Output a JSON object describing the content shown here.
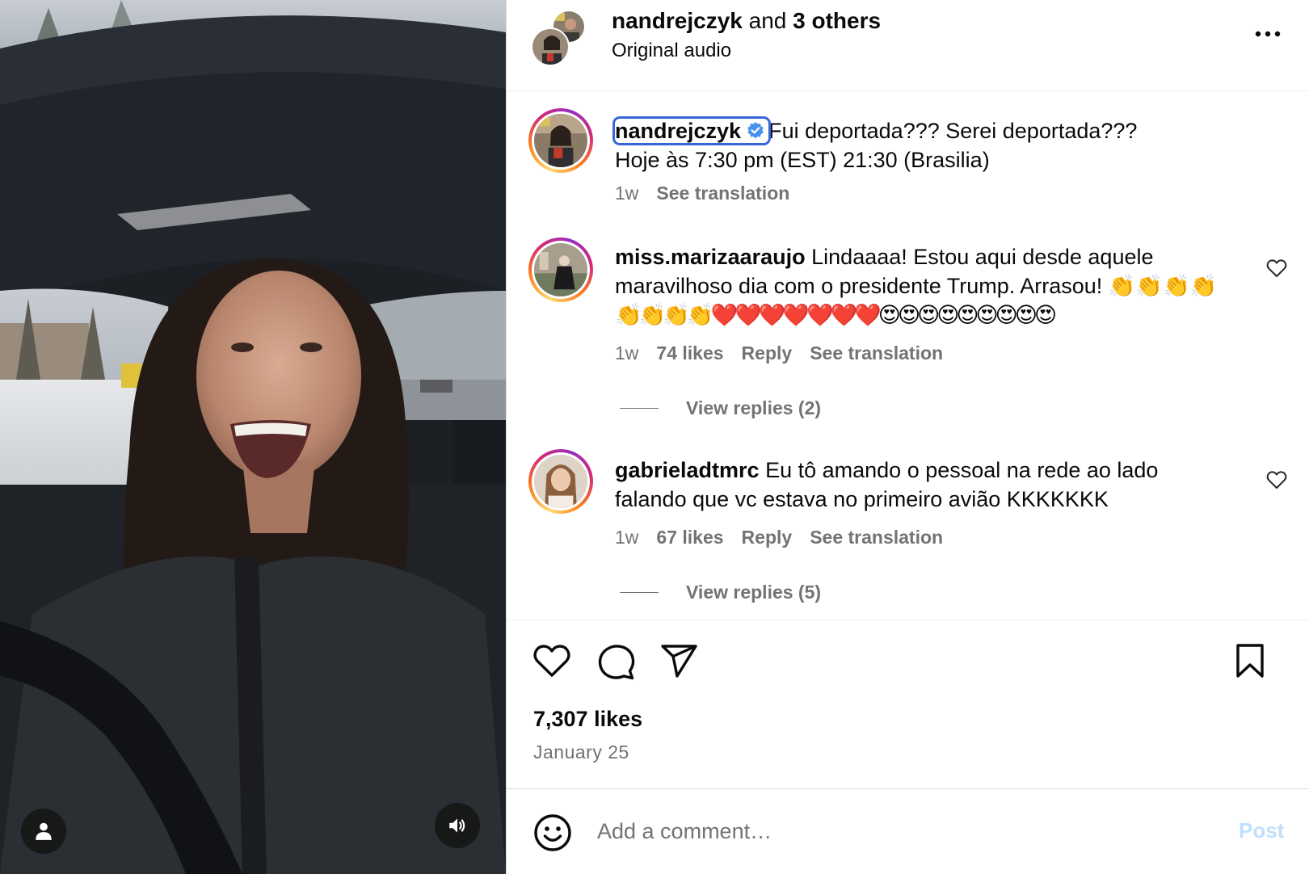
{
  "header": {
    "owner": "nandrejczyk",
    "joiner": "and",
    "others": "3 others",
    "audio": "Original audio",
    "more_icon": "more-horizontal-icon"
  },
  "caption": {
    "username": "nandrejczyk",
    "verified": true,
    "text_line1": "Fui deportada??? Serei deportada???",
    "text_line2": "Hoje às 7:30 pm (EST) 21:30 (Brasilia)",
    "age": "1w",
    "translate": "See translation"
  },
  "comments": [
    {
      "username": "miss.marizaaraujo",
      "text_line1": "Lindaaaa! Estou aqui desde aquele",
      "text_line2": "maravilhoso dia com o presidente Trump. Arrasou! 👏👏👏👏",
      "text_line3": "👏👏👏👏❤️❤️❤️❤️❤️❤️❤️😍😍😍😍😍😍😍😍😍",
      "age": "1w",
      "likes": "74 likes",
      "reply": "Reply",
      "translate": "See translation",
      "view_replies": "View replies (2)"
    },
    {
      "username": "gabrieladtmrc",
      "text_line1": "Eu tô amando o pessoal na rede ao lado",
      "text_line2": "falando que vc estava no primeiro avião KKKKKKK",
      "age": "1w",
      "likes": "67 likes",
      "reply": "Reply",
      "translate": "See translation",
      "view_replies": "View replies (5)"
    }
  ],
  "actions": {
    "like_icon": "heart-icon",
    "comment_icon": "comment-icon",
    "share_icon": "paper-plane-icon",
    "save_icon": "bookmark-icon"
  },
  "likes": "7,307 likes",
  "date": "January 25",
  "compose": {
    "placeholder": "Add a comment…",
    "post": "Post"
  },
  "colors": {
    "verified": "#4a90f0",
    "post_disabled": "#c0dffd",
    "muted": "#737373",
    "highlight": "#3766d6"
  }
}
